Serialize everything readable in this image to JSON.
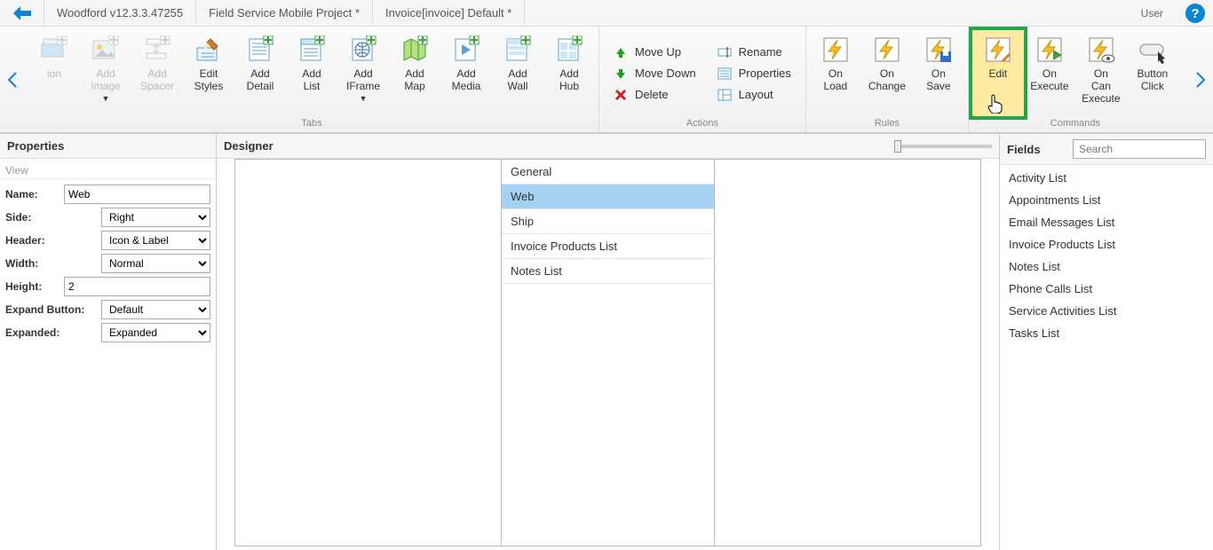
{
  "titlebar": {
    "tabs": [
      "Woodford v12.3.3.47255",
      "Field Service Mobile Project *",
      "Invoice[invoice] Default *"
    ],
    "user": "User"
  },
  "ribbon": {
    "tabs_group": {
      "label": "Tabs",
      "buttons": [
        {
          "label": "ion",
          "disabled": true,
          "icon": "section"
        },
        {
          "label": "Add Image",
          "disabled": true,
          "icon": "image",
          "arrow": true
        },
        {
          "label": "Add Spacer",
          "disabled": true,
          "icon": "spacer"
        },
        {
          "label": "Edit Styles",
          "icon": "styles"
        },
        {
          "label": "Add Detail",
          "icon": "detail"
        },
        {
          "label": "Add List",
          "icon": "list"
        },
        {
          "label": "Add IFrame",
          "icon": "iframe",
          "arrow": true
        },
        {
          "label": "Add Map",
          "icon": "map"
        },
        {
          "label": "Add Media",
          "icon": "media"
        },
        {
          "label": "Add Wall",
          "icon": "wall"
        },
        {
          "label": "Add Hub",
          "icon": "hub"
        }
      ]
    },
    "actions_group": {
      "label": "Actions",
      "text_buttons_1": [
        {
          "label": "Move Up",
          "icon": "up",
          "color": "#20a020"
        },
        {
          "label": "Move Down",
          "icon": "down",
          "color": "#20a020"
        },
        {
          "label": "Delete",
          "icon": "delete",
          "color": "#d02020"
        }
      ],
      "text_buttons_2": [
        {
          "label": "Rename",
          "icon": "rename"
        },
        {
          "label": "Properties",
          "icon": "props"
        },
        {
          "label": "Layout",
          "icon": "layout"
        }
      ]
    },
    "rules_group": {
      "label": "Rules",
      "buttons": [
        {
          "label": "On Load",
          "icon": "bolt"
        },
        {
          "label": "On Change",
          "icon": "bolt"
        },
        {
          "label": "On Save",
          "icon": "bolt-save"
        }
      ]
    },
    "commands_group": {
      "label": "Commands",
      "buttons": [
        {
          "label": "Edit",
          "icon": "bolt-edit",
          "highlight": true
        },
        {
          "label": "On Execute",
          "icon": "bolt-exec"
        },
        {
          "label": "On Can Execute",
          "icon": "bolt-eye"
        },
        {
          "label": "Button Click",
          "icon": "bolt-click",
          "cut": true
        }
      ]
    }
  },
  "properties": {
    "title": "Properties",
    "section": "View",
    "rows": [
      {
        "label": "Name:",
        "type": "text",
        "value": "Web"
      },
      {
        "label": "Side:",
        "type": "select",
        "value": "Right"
      },
      {
        "label": "Header:",
        "type": "select",
        "value": "Icon & Label"
      },
      {
        "label": "Width:",
        "type": "select",
        "value": "Normal"
      },
      {
        "label": "Height:",
        "type": "text",
        "value": "2"
      },
      {
        "label": "Expand Button:",
        "type": "select",
        "value": "Default"
      },
      {
        "label": "Expanded:",
        "type": "select",
        "value": "Expanded"
      }
    ]
  },
  "designer": {
    "title": "Designer",
    "tabs": [
      "General",
      "Web",
      "Ship",
      "Invoice Products List",
      "Notes List"
    ],
    "selected_tab": "Web"
  },
  "fields": {
    "title": "Fields",
    "search_placeholder": "Search",
    "items": [
      "Activity List",
      "Appointments List",
      "Email Messages List",
      "Invoice Products List",
      "Notes List",
      "Phone Calls List",
      "Service Activities List",
      "Tasks List"
    ]
  }
}
